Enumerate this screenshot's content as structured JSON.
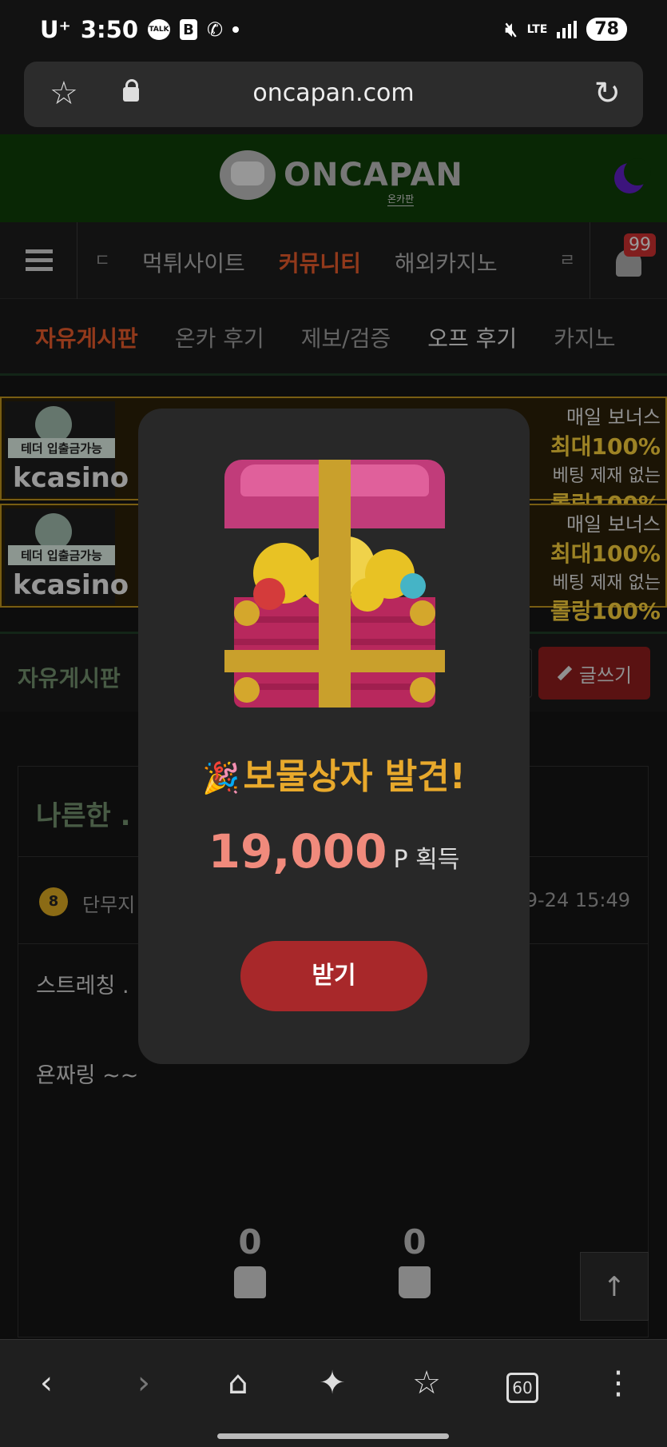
{
  "status_bar": {
    "carrier": "U⁺",
    "time": "3:50",
    "talk_label": "TALK",
    "b_icon": "B",
    "lte": "LTE",
    "battery": "78"
  },
  "browser": {
    "url": "oncapan.com"
  },
  "site": {
    "logo_text": "ONCAPAN",
    "logo_sub": "온카판"
  },
  "main_nav": {
    "left_edge": "ㄷ",
    "items": [
      "먹튀사이트",
      "커뮤니티",
      "해외카지노"
    ],
    "right_edge": "ㄹ",
    "badge": "99"
  },
  "sub_nav": {
    "items": [
      "자유게시판",
      "온카 후기",
      "제보/검증",
      "오프 후기",
      "카지노"
    ]
  },
  "banner": {
    "tag": "테더 입출금가능",
    "brand": "kcasino",
    "r1": "매일 보너스",
    "r2": "최대100%",
    "r3": "베팅 제재 없는",
    "r4": "롤링100%"
  },
  "board": {
    "title": "자유게시판",
    "write_label": "글쓰기"
  },
  "post": {
    "title": "나른한 .",
    "level": "8",
    "author": "단무지",
    "date": "09-24 15:49",
    "body_line1": "스트레칭 .",
    "body_line2": "욘짜링 ~~",
    "likes": "0",
    "dislikes": "0"
  },
  "modal": {
    "popper": "🎉",
    "title": "보물상자 발견!",
    "amount": "19,000",
    "unit": "P 획득",
    "button": "받기"
  },
  "bottom_bar": {
    "tabs_count": "60"
  },
  "colors": {
    "accent": "#e0582a",
    "header_green": "#0e3c08",
    "modal_bg": "#282828",
    "modal_button": "#a8282a",
    "amount": "#f08a7c",
    "title_gold": "#e8a92c"
  }
}
